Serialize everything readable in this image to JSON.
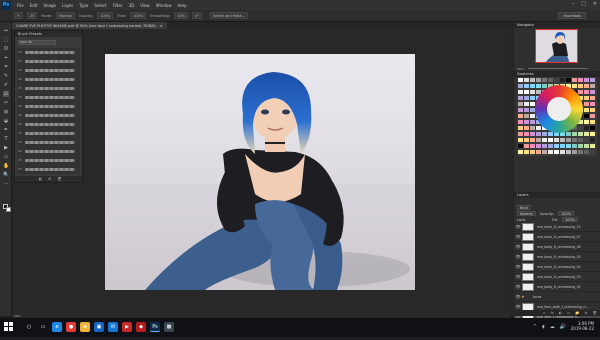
{
  "app": {
    "logo": "Ps",
    "menu": [
      "File",
      "Edit",
      "Image",
      "Layer",
      "Type",
      "Select",
      "Filter",
      "3D",
      "View",
      "Window",
      "Help"
    ],
    "window_controls": [
      "–",
      "□",
      "✕"
    ]
  },
  "options_bar": {
    "brush_size": "25",
    "mode_label": "Mode:",
    "mode_value": "Normal",
    "opacity_label": "Opacity:",
    "opacity_value": "100%",
    "flow_label": "Flow:",
    "flow_value": "100%",
    "smoothing_label": "Smoothing:",
    "smoothing_value": "10%",
    "angle_value": "0°",
    "select_mask": "Select and Mask...",
    "workspace": "Essentials"
  },
  "document": {
    "tab_title": "CHARE EVE PHOTOS INGAME.psd @ 50% (eve face f undressing normal, RGB/8)",
    "close_icon": "×"
  },
  "brush_presets": {
    "title": "Brush Presets",
    "size_button": "Size: 25",
    "sizes": [
      "25",
      "50",
      "25",
      "36",
      "25",
      "25",
      "36",
      "36",
      "36",
      "32",
      "25",
      "50",
      "25",
      "25"
    ],
    "footer_icons": [
      "◧",
      "⊞",
      "🗑"
    ]
  },
  "navigator": {
    "title": "Navigator",
    "zoom": "50%"
  },
  "swatches": {
    "title": "Swatches"
  },
  "layers": {
    "title": "Layers",
    "kind_label": "Kind",
    "blend_mode": "Normal",
    "opacity_label": "Opacity:",
    "opacity_value": "100%",
    "lock_label": "Lock:",
    "fill_label": "Fill:",
    "fill_value": "100%",
    "items": [
      {
        "name": "eve_body_6_undressing_10",
        "visible": true,
        "type": "layer"
      },
      {
        "name": "eve_body_6_undressing_07",
        "visible": true,
        "type": "layer"
      },
      {
        "name": "eve_body_6_undressing_06",
        "visible": true,
        "type": "layer"
      },
      {
        "name": "eve_body_6_undressing_05",
        "visible": true,
        "type": "layer"
      },
      {
        "name": "eve_body_6_undressing_04",
        "visible": true,
        "type": "layer"
      },
      {
        "name": "eve_body_6_undressing_03",
        "visible": true,
        "type": "layer"
      },
      {
        "name": "eve_body_6_undressing_02",
        "visible": true,
        "type": "layer"
      },
      {
        "name": "faces",
        "visible": true,
        "type": "group"
      },
      {
        "name": "eve_face_bath_f_undressing_n...",
        "visible": true,
        "type": "layer"
      },
      {
        "name": "eve_face_f_undressing_n...",
        "visible": true,
        "type": "layer",
        "active": true
      },
      {
        "name": "eve_body_6_undressing_01",
        "visible": true,
        "type": "layer"
      },
      {
        "name": "bg",
        "visible": true,
        "type": "group"
      }
    ],
    "footer_icons": [
      "∞",
      "fx",
      "◐",
      "▭",
      "📁",
      "⊕",
      "🗑"
    ]
  },
  "status": {
    "zoom": "50%"
  },
  "toolbar": {
    "tools": [
      "↔",
      "⬚",
      "ʘ",
      "⌖",
      "⌗",
      "✎",
      "✐",
      "⎌",
      "✂",
      "◍",
      "◒",
      "✒",
      "T",
      "▶",
      "▭",
      "✋",
      "🔍",
      "⋯"
    ]
  },
  "taskbar": {
    "icons": [
      {
        "name": "search",
        "glyph": "○",
        "color": "#0f1117"
      },
      {
        "name": "task-view",
        "glyph": "▭",
        "color": "#0f1117"
      },
      {
        "name": "edge",
        "glyph": "e",
        "color": "#1e88e5"
      },
      {
        "name": "chrome",
        "glyph": "●",
        "color": "#e53935"
      },
      {
        "name": "explorer",
        "glyph": "▰",
        "color": "#f2b33d"
      },
      {
        "name": "store",
        "glyph": "▣",
        "color": "#1565c0"
      },
      {
        "name": "mail",
        "glyph": "✉",
        "color": "#1976d2"
      },
      {
        "name": "media",
        "glyph": "▶",
        "color": "#c62828"
      },
      {
        "name": "app-red",
        "glyph": "◆",
        "color": "#b71c1c"
      },
      {
        "name": "photoshop",
        "glyph": "Ps",
        "color": "#0b2c4a"
      },
      {
        "name": "app-dark",
        "glyph": "▩",
        "color": "#37474f"
      }
    ],
    "time": "3:06 PM",
    "date": "2019-08-22",
    "tray_icons": [
      "^",
      "◖",
      "☁",
      "🔊"
    ]
  }
}
